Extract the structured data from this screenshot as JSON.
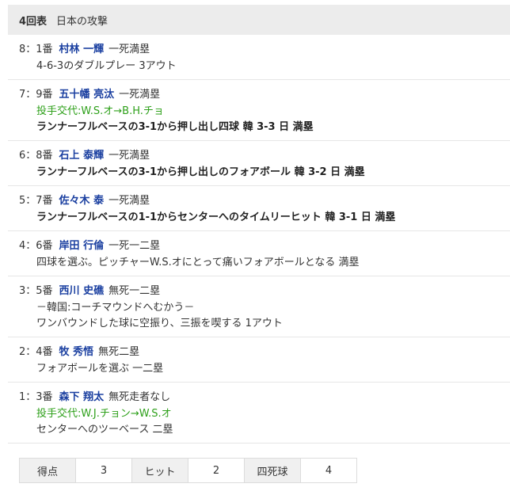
{
  "header": {
    "inning": "4回表",
    "team_attack": "日本の攻撃"
  },
  "plays": [
    {
      "num": "8：1番",
      "player": "村林 一輝",
      "situation": "一死満塁",
      "lines": [
        {
          "style": "norm",
          "text": "4-6-3のダブルプレー 3アウト"
        }
      ]
    },
    {
      "num": "7：9番",
      "player": "五十幡 亮汰",
      "situation": "一死満塁",
      "lines": [
        {
          "style": "change",
          "text": "投手交代:W.S.オ→B.H.チョ"
        },
        {
          "style": "bold",
          "text": "ランナーフルベースの3-1から押し出し四球 韓 3-3 日 満塁"
        }
      ]
    },
    {
      "num": "6：8番",
      "player": "石上 泰輝",
      "situation": "一死満塁",
      "lines": [
        {
          "style": "bold",
          "text": "ランナーフルベースの3-1から押し出しのフォアボール 韓 3-2 日 満塁"
        }
      ]
    },
    {
      "num": "5：7番",
      "player": "佐々木 泰",
      "situation": "一死満塁",
      "lines": [
        {
          "style": "bold",
          "text": "ランナーフルベースの1-1からセンターへのタイムリーヒット 韓 3-1 日 満塁"
        }
      ]
    },
    {
      "num": "4：6番",
      "player": "岸田 行倫",
      "situation": "一死一二塁",
      "lines": [
        {
          "style": "norm",
          "text": "四球を選ぶ。ピッチャーW.S.オにとって痛いフォアボールとなる 満塁"
        }
      ]
    },
    {
      "num": "3：5番",
      "player": "西川 史礁",
      "situation": "無死一二塁",
      "lines": [
        {
          "style": "norm",
          "text": "－韓国:コーチマウンドへむかう－"
        },
        {
          "style": "norm",
          "text": "ワンバウンドした球に空振り、三振を喫する 1アウト"
        }
      ]
    },
    {
      "num": "2：4番",
      "player": "牧 秀悟",
      "situation": "無死二塁",
      "lines": [
        {
          "style": "norm",
          "text": "フォアボールを選ぶ 一二塁"
        }
      ]
    },
    {
      "num": "1：3番",
      "player": "森下 翔太",
      "situation": "無死走者なし",
      "lines": [
        {
          "style": "change",
          "text": "投手交代:W.J.チョン→W.S.オ"
        },
        {
          "style": "norm",
          "text": "センターへのツーベース 二塁"
        }
      ]
    }
  ],
  "summary": {
    "runs_label": "得点",
    "runs": "3",
    "hits_label": "ヒット",
    "hits": "2",
    "walks_label": "四死球",
    "walks": "4"
  },
  "colors": {
    "player": "#1a3fa0",
    "pitcher_change": "#2ea01a",
    "header_bg": "#ececec"
  }
}
